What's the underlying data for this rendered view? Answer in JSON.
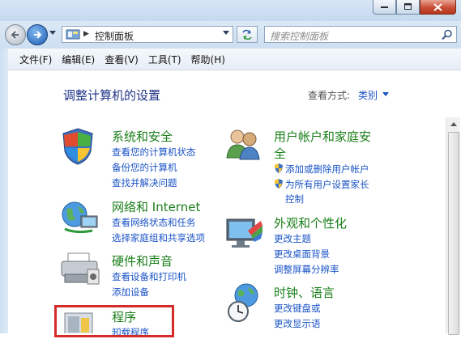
{
  "address": {
    "path": "控制面板",
    "search_placeholder": "搜索控制面板"
  },
  "menu": [
    "文件(F)",
    "编辑(E)",
    "查看(V)",
    "工具(T)",
    "帮助(H)"
  ],
  "page": {
    "title": "调整计算机的设置",
    "view_by_label": "查看方式:",
    "view_by_value": "类别"
  },
  "categories": {
    "system": {
      "title": "系统和安全",
      "links": [
        "查看您的计算机状态",
        "备份您的计算机",
        "查找并解决问题"
      ]
    },
    "network": {
      "title": "网络和 Internet",
      "links": [
        "查看网络状态和任务",
        "选择家庭组和共享选项"
      ]
    },
    "hardware": {
      "title": "硬件和声音",
      "links": [
        "查看设备和打印机",
        "添加设备"
      ]
    },
    "programs": {
      "title": "程序",
      "links": [
        "卸载程序"
      ]
    },
    "users": {
      "title_line1": "用户帐户和家庭安",
      "title_line2": "全",
      "links": [
        "添加或删除用户帐户",
        "为所有用户设置家长",
        "控制"
      ]
    },
    "appearance": {
      "title": "外观和个性化",
      "links": [
        "更改主题",
        "更改桌面背景",
        "调整屏幕分辨率"
      ]
    },
    "clock": {
      "title": "时钟、语言",
      "links": [
        "更改键盘或",
        "更改显示语"
      ]
    }
  },
  "colors": {
    "link": "#1a53c6",
    "category_title": "#1a7e1a",
    "page_title": "#1e3287",
    "highlight": "#d42a2a"
  }
}
